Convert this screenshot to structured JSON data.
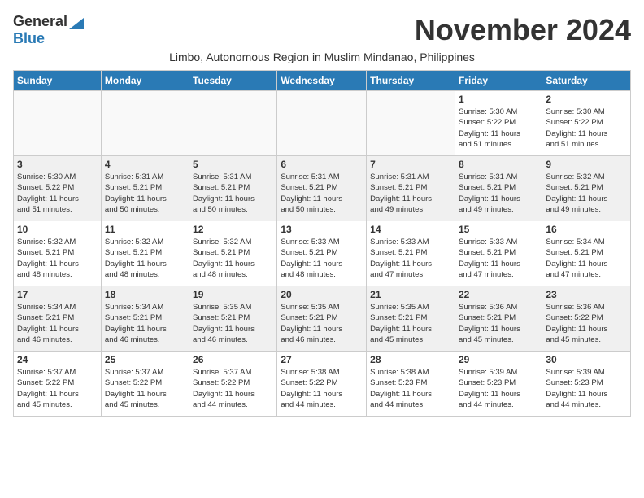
{
  "header": {
    "logo_general": "General",
    "logo_blue": "Blue",
    "month_year": "November 2024",
    "subtitle": "Limbo, Autonomous Region in Muslim Mindanao, Philippines"
  },
  "days_of_week": [
    "Sunday",
    "Monday",
    "Tuesday",
    "Wednesday",
    "Thursday",
    "Friday",
    "Saturday"
  ],
  "weeks": [
    {
      "shaded": false,
      "days": [
        {
          "num": "",
          "info": ""
        },
        {
          "num": "",
          "info": ""
        },
        {
          "num": "",
          "info": ""
        },
        {
          "num": "",
          "info": ""
        },
        {
          "num": "",
          "info": ""
        },
        {
          "num": "1",
          "info": "Sunrise: 5:30 AM\nSunset: 5:22 PM\nDaylight: 11 hours\nand 51 minutes."
        },
        {
          "num": "2",
          "info": "Sunrise: 5:30 AM\nSunset: 5:22 PM\nDaylight: 11 hours\nand 51 minutes."
        }
      ]
    },
    {
      "shaded": true,
      "days": [
        {
          "num": "3",
          "info": "Sunrise: 5:30 AM\nSunset: 5:22 PM\nDaylight: 11 hours\nand 51 minutes."
        },
        {
          "num": "4",
          "info": "Sunrise: 5:31 AM\nSunset: 5:21 PM\nDaylight: 11 hours\nand 50 minutes."
        },
        {
          "num": "5",
          "info": "Sunrise: 5:31 AM\nSunset: 5:21 PM\nDaylight: 11 hours\nand 50 minutes."
        },
        {
          "num": "6",
          "info": "Sunrise: 5:31 AM\nSunset: 5:21 PM\nDaylight: 11 hours\nand 50 minutes."
        },
        {
          "num": "7",
          "info": "Sunrise: 5:31 AM\nSunset: 5:21 PM\nDaylight: 11 hours\nand 49 minutes."
        },
        {
          "num": "8",
          "info": "Sunrise: 5:31 AM\nSunset: 5:21 PM\nDaylight: 11 hours\nand 49 minutes."
        },
        {
          "num": "9",
          "info": "Sunrise: 5:32 AM\nSunset: 5:21 PM\nDaylight: 11 hours\nand 49 minutes."
        }
      ]
    },
    {
      "shaded": false,
      "days": [
        {
          "num": "10",
          "info": "Sunrise: 5:32 AM\nSunset: 5:21 PM\nDaylight: 11 hours\nand 48 minutes."
        },
        {
          "num": "11",
          "info": "Sunrise: 5:32 AM\nSunset: 5:21 PM\nDaylight: 11 hours\nand 48 minutes."
        },
        {
          "num": "12",
          "info": "Sunrise: 5:32 AM\nSunset: 5:21 PM\nDaylight: 11 hours\nand 48 minutes."
        },
        {
          "num": "13",
          "info": "Sunrise: 5:33 AM\nSunset: 5:21 PM\nDaylight: 11 hours\nand 48 minutes."
        },
        {
          "num": "14",
          "info": "Sunrise: 5:33 AM\nSunset: 5:21 PM\nDaylight: 11 hours\nand 47 minutes."
        },
        {
          "num": "15",
          "info": "Sunrise: 5:33 AM\nSunset: 5:21 PM\nDaylight: 11 hours\nand 47 minutes."
        },
        {
          "num": "16",
          "info": "Sunrise: 5:34 AM\nSunset: 5:21 PM\nDaylight: 11 hours\nand 47 minutes."
        }
      ]
    },
    {
      "shaded": true,
      "days": [
        {
          "num": "17",
          "info": "Sunrise: 5:34 AM\nSunset: 5:21 PM\nDaylight: 11 hours\nand 46 minutes."
        },
        {
          "num": "18",
          "info": "Sunrise: 5:34 AM\nSunset: 5:21 PM\nDaylight: 11 hours\nand 46 minutes."
        },
        {
          "num": "19",
          "info": "Sunrise: 5:35 AM\nSunset: 5:21 PM\nDaylight: 11 hours\nand 46 minutes."
        },
        {
          "num": "20",
          "info": "Sunrise: 5:35 AM\nSunset: 5:21 PM\nDaylight: 11 hours\nand 46 minutes."
        },
        {
          "num": "21",
          "info": "Sunrise: 5:35 AM\nSunset: 5:21 PM\nDaylight: 11 hours\nand 45 minutes."
        },
        {
          "num": "22",
          "info": "Sunrise: 5:36 AM\nSunset: 5:21 PM\nDaylight: 11 hours\nand 45 minutes."
        },
        {
          "num": "23",
          "info": "Sunrise: 5:36 AM\nSunset: 5:22 PM\nDaylight: 11 hours\nand 45 minutes."
        }
      ]
    },
    {
      "shaded": false,
      "days": [
        {
          "num": "24",
          "info": "Sunrise: 5:37 AM\nSunset: 5:22 PM\nDaylight: 11 hours\nand 45 minutes."
        },
        {
          "num": "25",
          "info": "Sunrise: 5:37 AM\nSunset: 5:22 PM\nDaylight: 11 hours\nand 45 minutes."
        },
        {
          "num": "26",
          "info": "Sunrise: 5:37 AM\nSunset: 5:22 PM\nDaylight: 11 hours\nand 44 minutes."
        },
        {
          "num": "27",
          "info": "Sunrise: 5:38 AM\nSunset: 5:22 PM\nDaylight: 11 hours\nand 44 minutes."
        },
        {
          "num": "28",
          "info": "Sunrise: 5:38 AM\nSunset: 5:23 PM\nDaylight: 11 hours\nand 44 minutes."
        },
        {
          "num": "29",
          "info": "Sunrise: 5:39 AM\nSunset: 5:23 PM\nDaylight: 11 hours\nand 44 minutes."
        },
        {
          "num": "30",
          "info": "Sunrise: 5:39 AM\nSunset: 5:23 PM\nDaylight: 11 hours\nand 44 minutes."
        }
      ]
    }
  ]
}
